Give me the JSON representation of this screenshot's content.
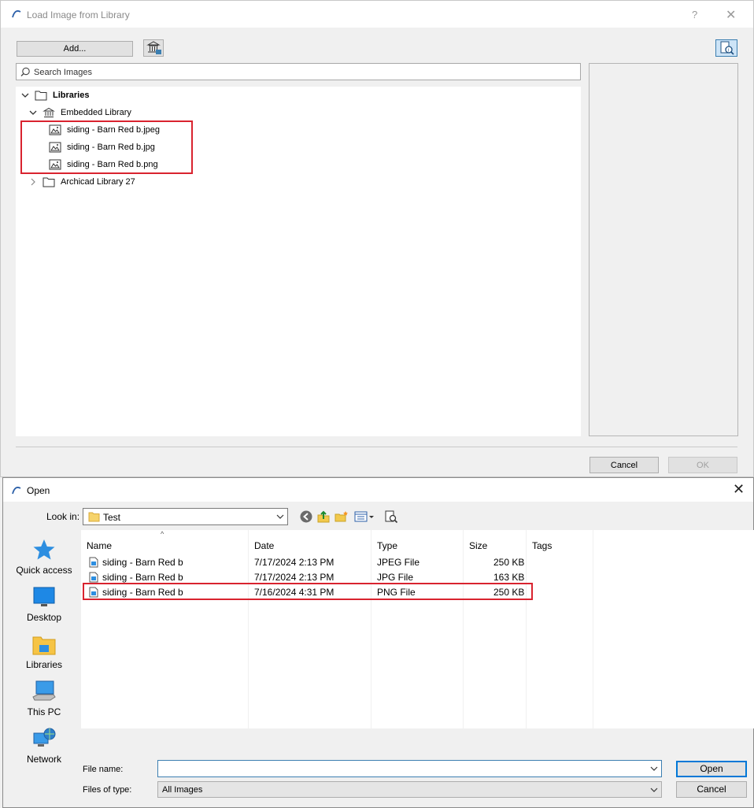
{
  "library_dialog": {
    "title": "Load Image from Library",
    "help_label": "?",
    "close_label": "✕",
    "add_button_label": "Add...",
    "search_placeholder": "Search Images",
    "tree": {
      "root_label": "Libraries",
      "embedded_label": "Embedded Library",
      "embedded_items": [
        "siding - Barn Red b.jpeg",
        "siding - Barn Red b.jpg",
        "siding - Barn Red b.png"
      ],
      "archicad_label": "Archicad Library 27"
    },
    "cancel_label": "Cancel",
    "ok_label": "OK"
  },
  "open_dialog": {
    "title": "Open",
    "close_label": "✕",
    "look_in_label": "Look in:",
    "look_in_value": "Test",
    "places": [
      "Quick access",
      "Desktop",
      "Libraries",
      "This PC",
      "Network"
    ],
    "columns": [
      "Name",
      "Date",
      "Type",
      "Size",
      "Tags"
    ],
    "sort_indicator": "^",
    "rows": [
      {
        "name": "siding - Barn Red b",
        "date": "7/17/2024 2:13 PM",
        "type": "JPEG File",
        "size": "250 KB"
      },
      {
        "name": "siding - Barn Red b",
        "date": "7/17/2024 2:13 PM",
        "type": "JPG File",
        "size": "163 KB"
      },
      {
        "name": "siding - Barn Red b",
        "date": "7/16/2024 4:31 PM",
        "type": "PNG File",
        "size": "250 KB"
      }
    ],
    "file_name_label": "File name:",
    "file_name_value": "",
    "files_of_type_label": "Files of type:",
    "files_of_type_value": "All Images",
    "open_label": "Open",
    "cancel_label": "Cancel"
  },
  "colors": {
    "highlight": "#d9232f",
    "accent": "#0078d7"
  }
}
